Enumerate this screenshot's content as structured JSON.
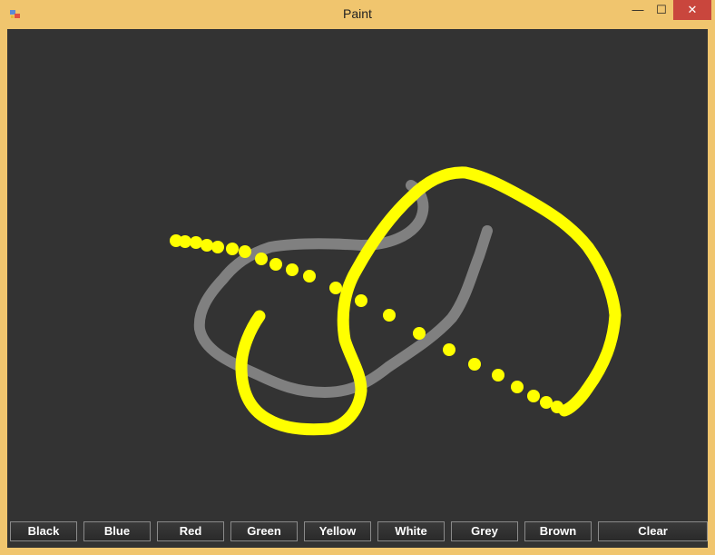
{
  "window": {
    "title": "Paint"
  },
  "title_controls": {
    "minimize": "—",
    "maximize": "☐",
    "close": "✕"
  },
  "colors": {
    "frame": "#f0c56e",
    "canvas_bg": "#333333",
    "grey_stroke": "#808080",
    "yellow_stroke": "#ffff00",
    "close_button": "#c9463d"
  },
  "toolbar": {
    "buttons": [
      "Black",
      "Blue",
      "Red",
      "Green",
      "Yellow",
      "White",
      "Grey",
      "Brown",
      "Clear"
    ]
  }
}
